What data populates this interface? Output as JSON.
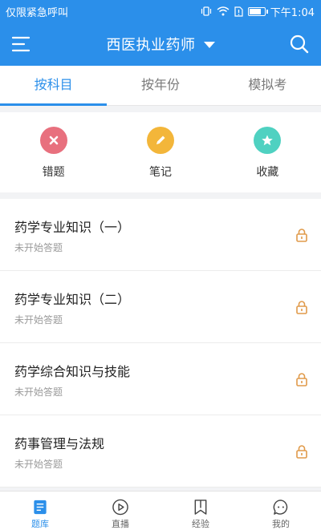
{
  "status_bar": {
    "left_text": "仅限紧急呼叫",
    "time": "下午1:04"
  },
  "header": {
    "title": "西医执业药师",
    "menu_icon": "menu-icon",
    "search_icon": "search-icon"
  },
  "tabs": [
    {
      "label": "按科目",
      "active": true
    },
    {
      "label": "按年份",
      "active": false
    },
    {
      "label": "模拟考",
      "active": false
    }
  ],
  "quick_actions": [
    {
      "label": "错题",
      "icon": "x-icon",
      "color": "#e8707e"
    },
    {
      "label": "笔记",
      "icon": "pencil-icon",
      "color": "#f3b63a"
    },
    {
      "label": "收藏",
      "icon": "star-icon",
      "color": "#4fd1c1"
    }
  ],
  "subjects": [
    {
      "name": "药学专业知识（一）",
      "status": "未开始答题"
    },
    {
      "name": "药学专业知识（二）",
      "status": "未开始答题"
    },
    {
      "name": "药学综合知识与技能",
      "status": "未开始答题"
    },
    {
      "name": "药事管理与法规",
      "status": "未开始答题"
    }
  ],
  "bottom_nav": [
    {
      "label": "题库",
      "icon": "question-bank-icon",
      "active": true
    },
    {
      "label": "直播",
      "icon": "play-icon",
      "active": false
    },
    {
      "label": "经验",
      "icon": "bookmark-icon",
      "active": false
    },
    {
      "label": "我的",
      "icon": "chat-icon",
      "active": false
    }
  ],
  "colors": {
    "primary": "#2b8fea",
    "lock": "#e09a4a"
  }
}
